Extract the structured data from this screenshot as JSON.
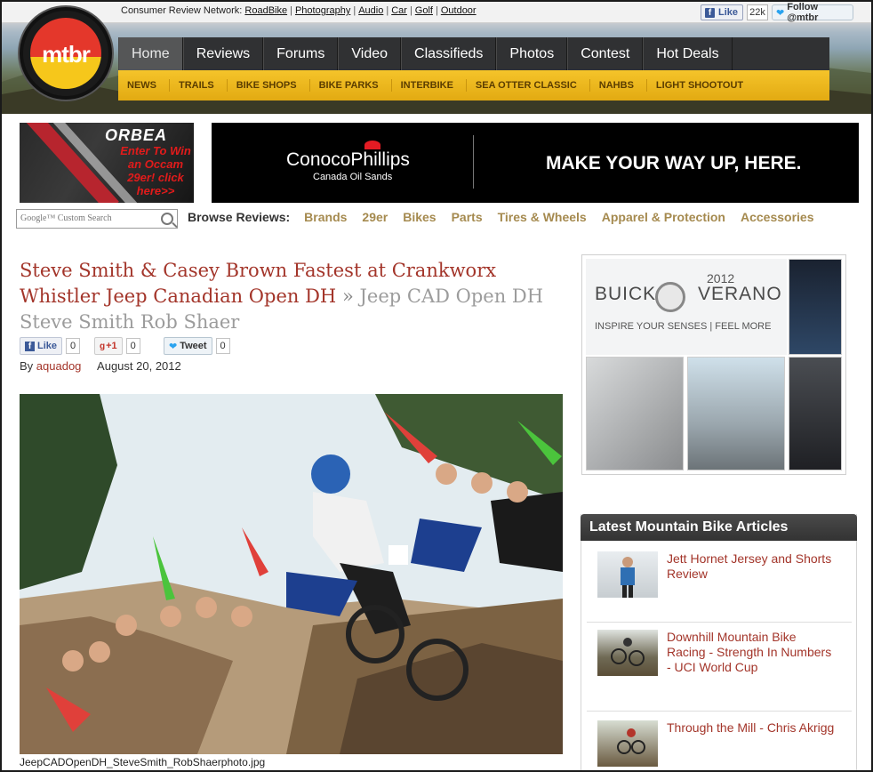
{
  "header": {
    "network_label": "Consumer Review Network:",
    "network_links": [
      "RoadBike",
      "Photography",
      "Audio",
      "Car",
      "Golf",
      "Outdoor"
    ],
    "fb_like_label": "Like",
    "fb_like_count": "22k",
    "twitter_follow_label": "Follow @mtbr",
    "logo_text": "mtbr",
    "nav_items": [
      "Home",
      "Reviews",
      "Forums",
      "Video",
      "Classifieds",
      "Photos",
      "Contest",
      "Hot Deals"
    ],
    "subnav_items": [
      "NEWS",
      "TRAILS",
      "BIKE SHOPS",
      "BIKE PARKS",
      "INTERBIKE",
      "SEA OTTER CLASSIC",
      "NAHBS",
      "LIGHT SHOOTOUT"
    ]
  },
  "ads": {
    "orbea_brand": "ORBEA",
    "orbea_cta": "Enter To Win an Occam 29er! click here>>",
    "conoco_brand": "ConocoPhillips",
    "conoco_sub": "Canada Oil Sands",
    "conoco_slogan": "MAKE YOUR WAY UP, HERE.",
    "buick_year": "2012",
    "buick_make": "BUICK",
    "buick_model": "VERANO",
    "buick_tagline": "INSPIRE YOUR SENSES | FEEL MORE"
  },
  "search": {
    "placeholder": "Google™ Custom Search"
  },
  "browse": {
    "label": "Browse Reviews:",
    "links": [
      "Brands",
      "29er",
      "Bikes",
      "Parts",
      "Tires & Wheels",
      "Apparel & Protection",
      "Accessories"
    ]
  },
  "article": {
    "title": "Steve Smith & Casey Brown Fastest at Crankworx Whistler Jeep Canadian Open DH",
    "separator": "»",
    "crumb": "Jeep CAD Open DH Steve Smith Rob Shaer",
    "share": {
      "fb_label": "Like",
      "fb_count": "0",
      "gplus_label": "+1",
      "gplus_count": "0",
      "tweet_label": "Tweet",
      "tweet_count": "0"
    },
    "by_label": "By",
    "author": "aquadog",
    "date": "August 20, 2012",
    "photo_caption": "JeepCADOpenDH_SteveSmith_RobShaerphoto.jpg"
  },
  "sidebar": {
    "latest_title": "Latest Mountain Bike Articles",
    "articles": [
      {
        "title": "Jett Hornet Jersey and Shorts Review"
      },
      {
        "title": "Downhill Mountain Bike Racing - Strength In Numbers - UCI World Cup"
      },
      {
        "title": "Through the Mill - Chris Akrigg"
      }
    ]
  },
  "colors": {
    "accent_red": "#a3352a",
    "nav_bg": "#303133",
    "subnav_yellow": "#f5c42a",
    "browse_link": "#a58a4f"
  }
}
